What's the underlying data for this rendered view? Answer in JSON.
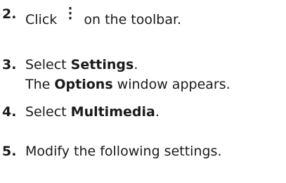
{
  "steps": [
    {
      "number": "2.",
      "before": "Click",
      "icon": "more-vertical-icon",
      "after": "on the toolbar."
    },
    {
      "number": "3.",
      "line1_prefix": "Select ",
      "line1_bold": "Settings",
      "line1_suffix": ".",
      "line2_prefix": "The ",
      "line2_bold": "Options",
      "line2_suffix": " window appears."
    },
    {
      "number": "4.",
      "prefix": "Select ",
      "bold": "Multimedia",
      "suffix": "."
    },
    {
      "number": "5.",
      "text": "Modify the following settings."
    }
  ]
}
